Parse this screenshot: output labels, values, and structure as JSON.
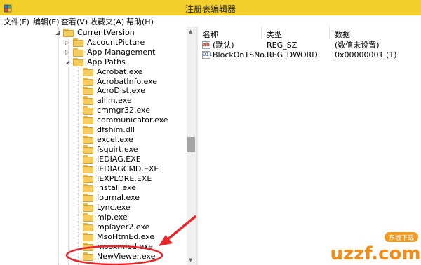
{
  "window": {
    "title": "注册表编辑器"
  },
  "menu": [
    "文件(F)",
    "编辑(E)",
    "查看(V)",
    "收藏夹(A)",
    "帮助(H)"
  ],
  "tree": {
    "items": [
      {
        "label": "CurrentVersion",
        "expander": "open"
      },
      {
        "label": "AccountPicture",
        "expander": "closed"
      },
      {
        "label": "App Management",
        "expander": "closed"
      },
      {
        "label": "App Paths",
        "expander": "open"
      },
      {
        "label": "Acrobat.exe",
        "expander": ""
      },
      {
        "label": "AcrobatInfo.exe",
        "expander": ""
      },
      {
        "label": "AcroDist.exe",
        "expander": ""
      },
      {
        "label": "aliim.exe",
        "expander": ""
      },
      {
        "label": "cmmgr32.exe",
        "expander": ""
      },
      {
        "label": "communicator.exe",
        "expander": ""
      },
      {
        "label": "dfshim.dll",
        "expander": ""
      },
      {
        "label": "excel.exe",
        "expander": ""
      },
      {
        "label": "fsquirt.exe",
        "expander": ""
      },
      {
        "label": "IEDIAG.EXE",
        "expander": ""
      },
      {
        "label": "IEDIAGCMD.EXE",
        "expander": ""
      },
      {
        "label": "IEXPLORE.EXE",
        "expander": ""
      },
      {
        "label": "install.exe",
        "expander": ""
      },
      {
        "label": "Journal.exe",
        "expander": ""
      },
      {
        "label": "Lync.exe",
        "expander": ""
      },
      {
        "label": "mip.exe",
        "expander": ""
      },
      {
        "label": "mplayer2.exe",
        "expander": ""
      },
      {
        "label": "MsoHtmEd.exe",
        "expander": ""
      },
      {
        "label": "msoxmled.exe",
        "expander": ""
      },
      {
        "label": "NewViewer.exe",
        "expander": ""
      }
    ]
  },
  "list": {
    "headers": [
      "名称",
      "类型",
      "数据"
    ],
    "rows": [
      {
        "icon": "ab",
        "name": "(默认)",
        "type": "REG_SZ",
        "data": "(数值未设置)"
      },
      {
        "icon": "011",
        "name": "BlockOnTSNo...",
        "type": "REG_DWORD",
        "data": "0x00000001 (1)"
      }
    ]
  },
  "watermark": {
    "top": "东坡下载",
    "main": "uzzf.com"
  },
  "colors": {
    "titlebar": "#f3cf2b",
    "annotation": "#e8252b"
  }
}
